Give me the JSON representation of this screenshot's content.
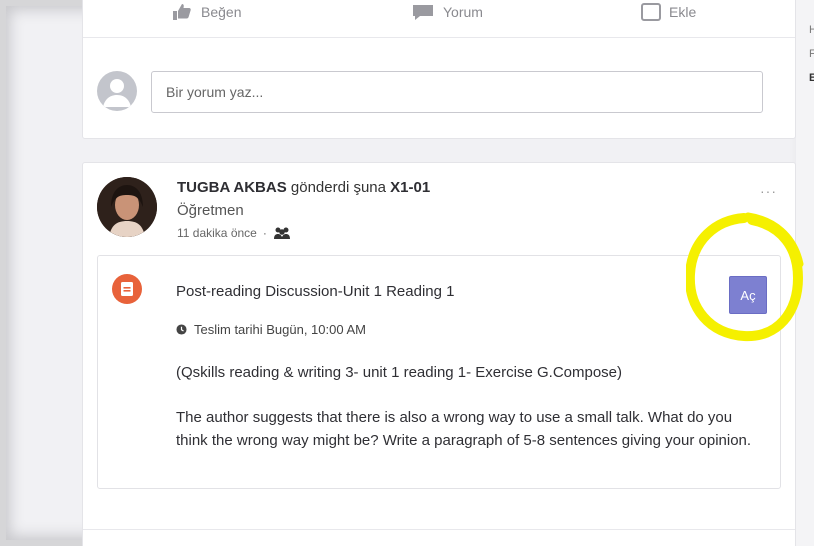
{
  "actions": {
    "like_label": "Beğen",
    "comment_label": "Yorum",
    "share_label": "Ekle"
  },
  "comment": {
    "placeholder": "Bir yorum yaz..."
  },
  "right_strip": [
    "H",
    "F",
    "E"
  ],
  "post": {
    "author": "TUGBA AKBAS",
    "verb": "gönderdi şuna",
    "target": "X1-01",
    "role": "Öğretmen",
    "time": "11 dakika önce",
    "separator": "·",
    "more": "···",
    "assignment": {
      "title": "Post-reading Discussion-Unit 1 Reading 1",
      "due": "Teslim tarihi Bugün, 10:00 AM",
      "open_label": "Aç",
      "paragraph1": "(Qskills reading & writing 3- unit 1 reading 1- Exercise G.Compose)",
      "paragraph2": "The author suggests that there is also a wrong way to use a small talk. What do you think the wrong way might be? Write a paragraph of 5-8 sentences giving your opinion."
    }
  },
  "colors": {
    "accent_button": "#7d80d1",
    "assignment_icon": "#e8623a",
    "highlight": "#f5f000"
  }
}
